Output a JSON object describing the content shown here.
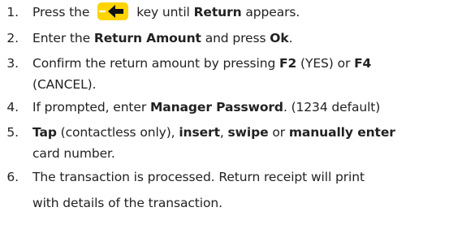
{
  "steps": [
    {
      "number": "1.",
      "parts": [
        "Press the",
        "key until",
        "Return",
        "appears."
      ],
      "icon": "backspace-arrow-icon",
      "icon_color": "#ffd400"
    },
    {
      "number": "2.",
      "parts": [
        "Enter the",
        "Return Amount",
        "and press",
        "Ok",
        "."
      ]
    },
    {
      "number": "3.",
      "line1_parts": [
        "Confirm the return amount by pressing",
        "F2",
        "(YES) or",
        "F4"
      ],
      "line2": "(CANCEL)."
    },
    {
      "number": "4.",
      "parts": [
        "If prompted, enter",
        "Manager Password",
        ". (1234 default)"
      ]
    },
    {
      "number": "5.",
      "line1_parts": [
        "Tap",
        "(contactless only),",
        "insert",
        ",",
        "swipe",
        "or",
        "manually enter"
      ],
      "line2": "card number."
    },
    {
      "number": "6.",
      "line1": "The transaction is processed. Return receipt will print",
      "line2": "with details of the transaction."
    }
  ]
}
